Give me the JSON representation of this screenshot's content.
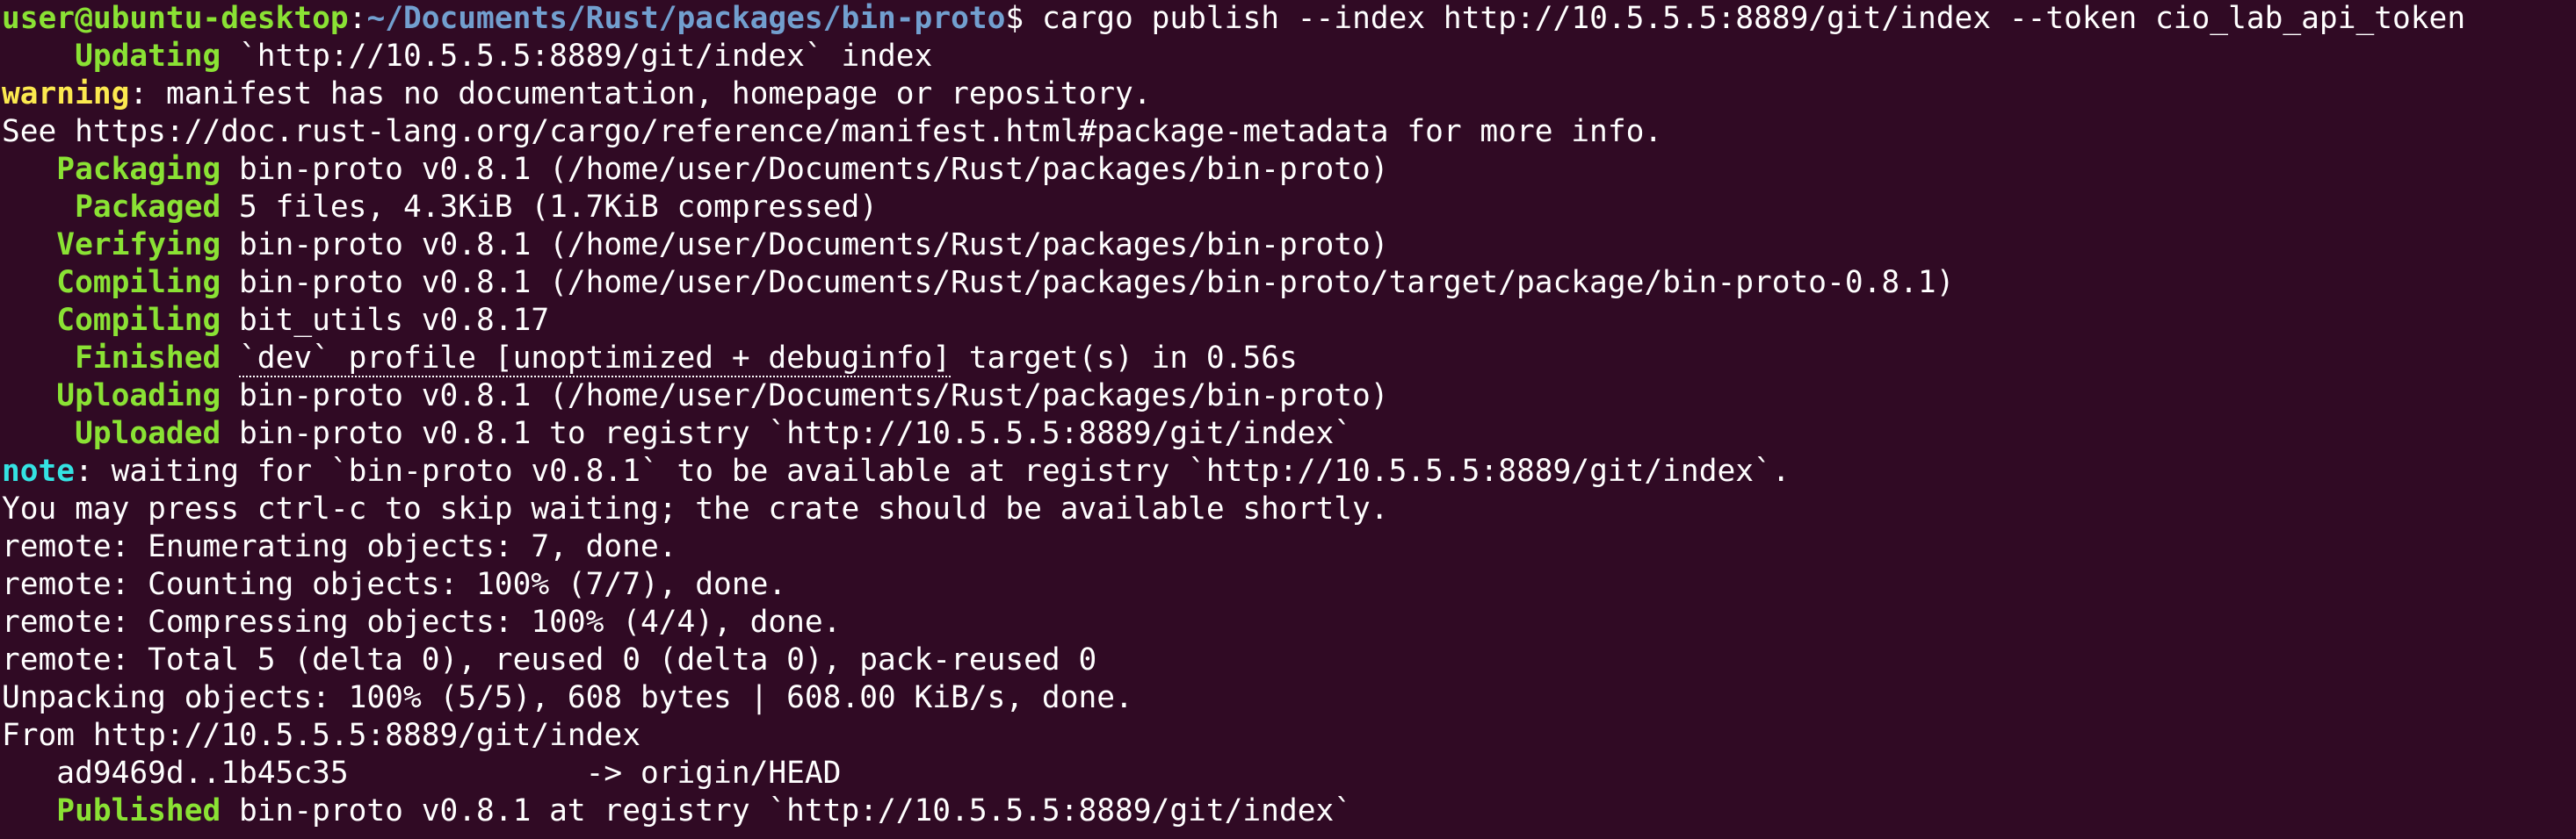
{
  "prompt": {
    "user": "user@ubuntu-desktop",
    "sep": ":",
    "path": "~/Documents/Rust/packages/bin-proto",
    "symbol": "$",
    "command": " cargo publish --index http://10.5.5.5:8889/git/index --token cio_lab_api_token"
  },
  "lines": {
    "l1": {
      "status": "    Updating",
      "rest": " `http://10.5.5.5:8889/git/index` index"
    },
    "l2": {
      "tag": "warning",
      "rest": ": manifest has no documentation, homepage or repository."
    },
    "l3": {
      "rest": "See https://doc.rust-lang.org/cargo/reference/manifest.html#package-metadata for more info."
    },
    "l4": {
      "status": "   Packaging",
      "rest": " bin-proto v0.8.1 (/home/user/Documents/Rust/packages/bin-proto)"
    },
    "l5": {
      "status": "    Packaged",
      "rest": " 5 files, 4.3KiB (1.7KiB compressed)"
    },
    "l6": {
      "status": "   Verifying",
      "rest": " bin-proto v0.8.1 (/home/user/Documents/Rust/packages/bin-proto)"
    },
    "l7": {
      "status": "   Compiling",
      "rest": " bin-proto v0.8.1 (/home/user/Documents/Rust/packages/bin-proto/target/package/bin-proto-0.8.1)"
    },
    "l8": {
      "status": "   Compiling",
      "rest": " bit_utils v0.8.17"
    },
    "l9": {
      "status": "    Finished",
      "pre": " ",
      "dotted": "`dev` profile [unoptimized + debuginfo]",
      "rest": " target(s) in 0.56s"
    },
    "l10": {
      "status": "   Uploading",
      "rest": " bin-proto v0.8.1 (/home/user/Documents/Rust/packages/bin-proto)"
    },
    "l11": {
      "status": "    Uploaded",
      "rest": " bin-proto v0.8.1 to registry `http://10.5.5.5:8889/git/index`"
    },
    "l12": {
      "tag": "note",
      "rest": ": waiting for `bin-proto v0.8.1` to be available at registry `http://10.5.5.5:8889/git/index`."
    },
    "l13": {
      "rest": "You may press ctrl-c to skip waiting; the crate should be available shortly."
    },
    "l14": {
      "rest": "remote: Enumerating objects: 7, done."
    },
    "l15": {
      "rest": "remote: Counting objects: 100% (7/7), done."
    },
    "l16": {
      "rest": "remote: Compressing objects: 100% (4/4), done."
    },
    "l17": {
      "rest": "remote: Total 5 (delta 0), reused 0 (delta 0), pack-reused 0"
    },
    "l18": {
      "rest": "Unpacking objects: 100% (5/5), 608 bytes | 608.00 KiB/s, done."
    },
    "l19": {
      "rest": "From http://10.5.5.5:8889/git/index"
    },
    "l20": {
      "rest": "   ad9469d..1b45c35             -> origin/HEAD"
    },
    "l21": {
      "status": "   Published",
      "rest": " bin-proto v0.8.1 at registry `http://10.5.5.5:8889/git/index`"
    }
  },
  "colors": {
    "background": "#300a24",
    "status_green": "#8ae234",
    "path_blue": "#729fcf",
    "warning_yellow": "#fce94f",
    "note_cyan": "#34e2e2"
  }
}
